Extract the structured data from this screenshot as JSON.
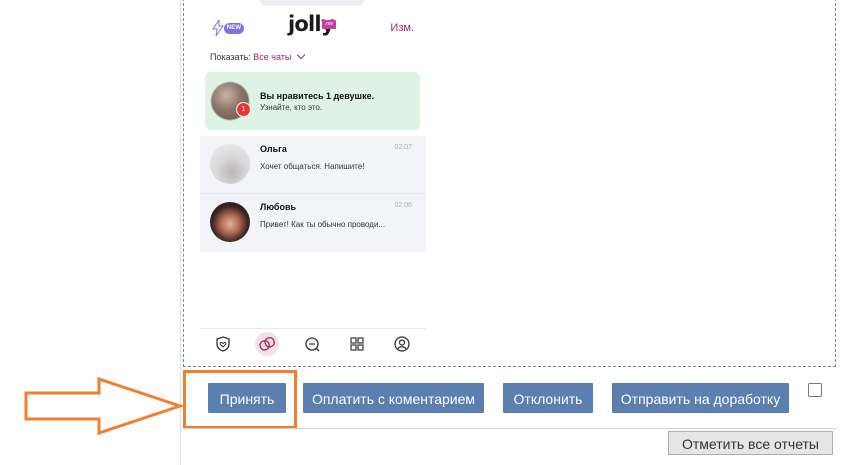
{
  "phone": {
    "new_badge": "NEW",
    "logo_text": "jolly",
    "logo_tag": ".me",
    "edit_label": "Изм.",
    "filter_label": "Показать:",
    "filter_value": "Все чаты",
    "likes_card": {
      "badge_count": "1",
      "title": "Вы нравитесь 1 девушке.",
      "subtitle": "Узнайте, кто это."
    },
    "chats": [
      {
        "name": "Ольга",
        "time": "02:07",
        "message": "Хочет общаться. Напишите!"
      },
      {
        "name": "Любовь",
        "time": "02:06",
        "message": "Привет! Как ты обычно проводи..."
      }
    ],
    "nav_icons": [
      "shield-heart-icon",
      "chat-bubbles-icon",
      "search-chat-icon",
      "grid-icon",
      "profile-icon"
    ]
  },
  "actions": {
    "accept": "Принять",
    "pay_with_comment": "Оплатить с коментарием",
    "decline": "Отклонить",
    "send_to_rework": "Отправить на доработку",
    "mark_all_reports": "Отметить все отчеты"
  },
  "colors": {
    "button_bg": "#5b7fae",
    "highlight": "#f27f2d",
    "likes_card_bg": "#dff3e4",
    "accent_purple": "#8a2d66"
  }
}
